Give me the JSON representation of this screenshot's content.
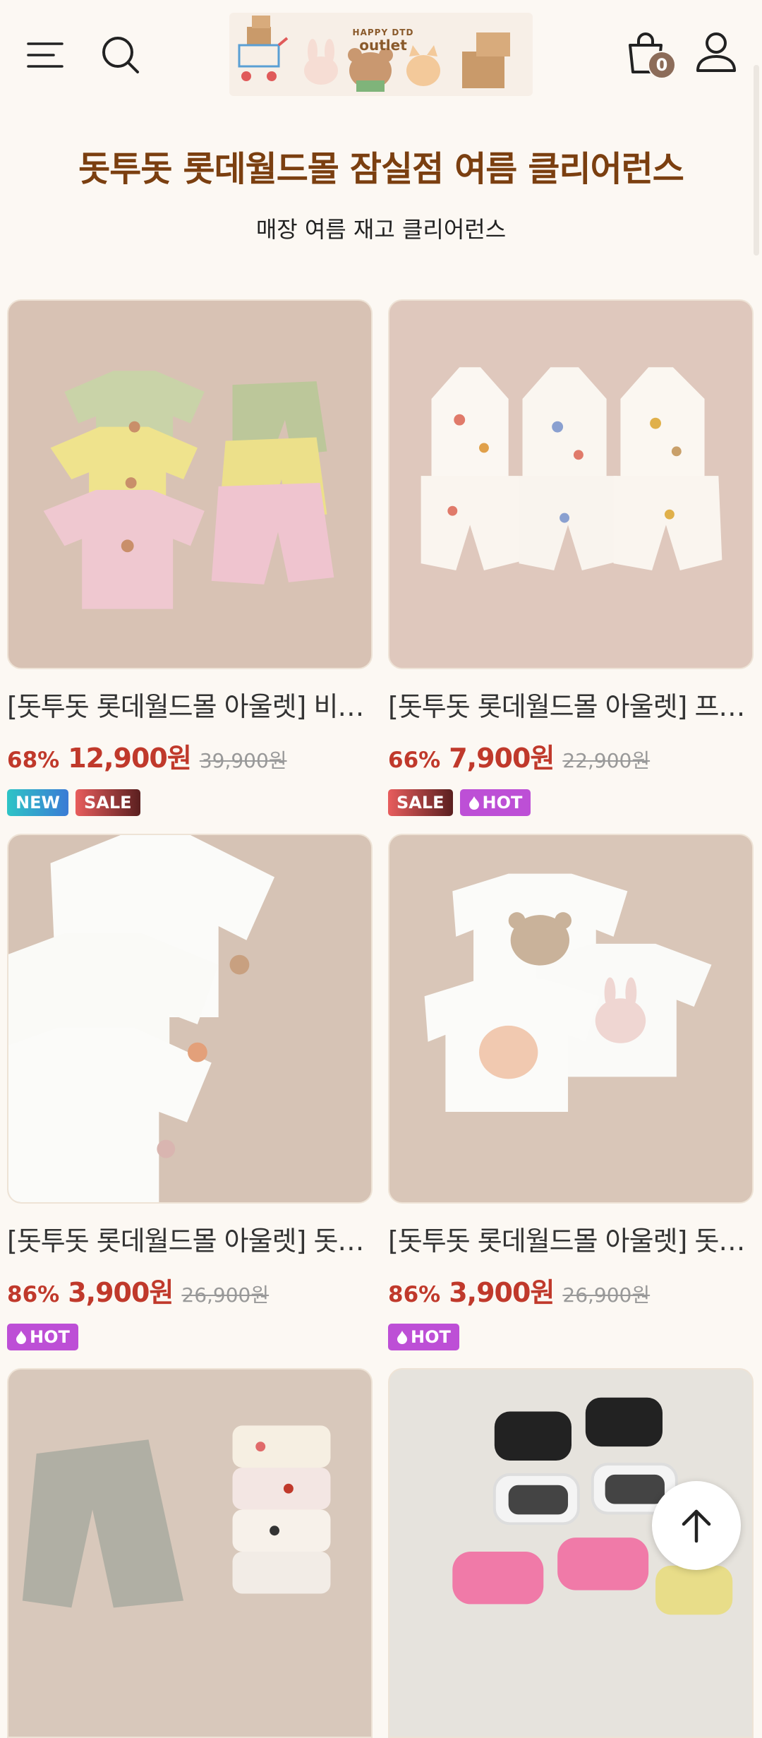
{
  "header": {
    "cart_count": "0",
    "logo": {
      "line1": "HAPPY DTD",
      "line2": "outlet"
    }
  },
  "page": {
    "title": "돗투돗 롯데월드몰 잠실점 여름 클리어런스",
    "subtitle": "매장 여름 재고 클리어런스"
  },
  "products": [
    {
      "name": "[돗투돗 롯데월드몰 아울렛] 비스...",
      "discount": "68%",
      "price": "12,900원",
      "original": "39,900원",
      "badges": [
        "NEW",
        "SALE"
      ]
    },
    {
      "name": "[돗투돗 롯데월드몰 아울렛] 프루...",
      "discount": "66%",
      "price": "7,900원",
      "original": "22,900원",
      "badges": [
        "SALE",
        "HOT"
      ]
    },
    {
      "name": "[돗투돗 롯데월드몰 아울렛] 돗니...",
      "discount": "86%",
      "price": "3,900원",
      "original": "26,900원",
      "badges": [
        "HOT"
      ]
    },
    {
      "name": "[돗투돗 롯데월드몰 아울렛] 돗니...",
      "discount": "86%",
      "price": "3,900원",
      "original": "26,900원",
      "badges": [
        "HOT"
      ]
    }
  ],
  "colors": {
    "background": "#fcf8f3",
    "title": "#7b3f10",
    "price": "#c0392b",
    "badge_hot": "#bd4fd6"
  },
  "icons": [
    "menu-icon",
    "search-icon",
    "shopping-bag-icon",
    "user-icon",
    "arrow-up-icon",
    "flame-icon"
  ]
}
